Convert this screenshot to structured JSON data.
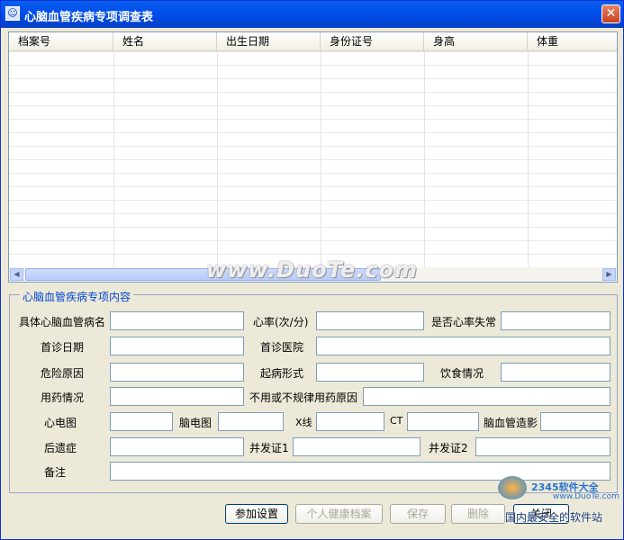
{
  "window": {
    "title": "心脑血管疾病专项调查表",
    "close": "✕"
  },
  "grid": {
    "columns": [
      "档案号",
      "姓名",
      "出生日期",
      "身份证号",
      "身高",
      "体重"
    ]
  },
  "group": {
    "title": "心脑血管疾病专项内容"
  },
  "form": {
    "disease_name": "具体心脑血管病名",
    "heart_rate": "心率(次/分)",
    "arrhythmia": "是否心率失常",
    "first_visit_date": "首诊日期",
    "first_visit_hospital": "首诊医院",
    "risk_cause": "危险原因",
    "onset_form": "起病形式",
    "diet": "饮食情况",
    "medication": "用药情况",
    "no_med_reason": "不用或不规律用药原因",
    "ecg": "心电图",
    "eeg": "脑电图",
    "xray": "X线",
    "ct": "CT",
    "angiography": "脑血管造影",
    "sequelae": "后遗症",
    "complication1": "并发证1",
    "complication2": "并发证2",
    "remarks": "备注"
  },
  "buttons": {
    "settings": "参加设置",
    "health_record": "个人健康档案",
    "save": "保存",
    "delete": "删除",
    "close": "关闭"
  },
  "watermark": {
    "main": "www.DuoTe.com",
    "site": "国内最安全的软件站",
    "brand": "2345软件大全",
    "url": "www.DuoTe.com"
  }
}
